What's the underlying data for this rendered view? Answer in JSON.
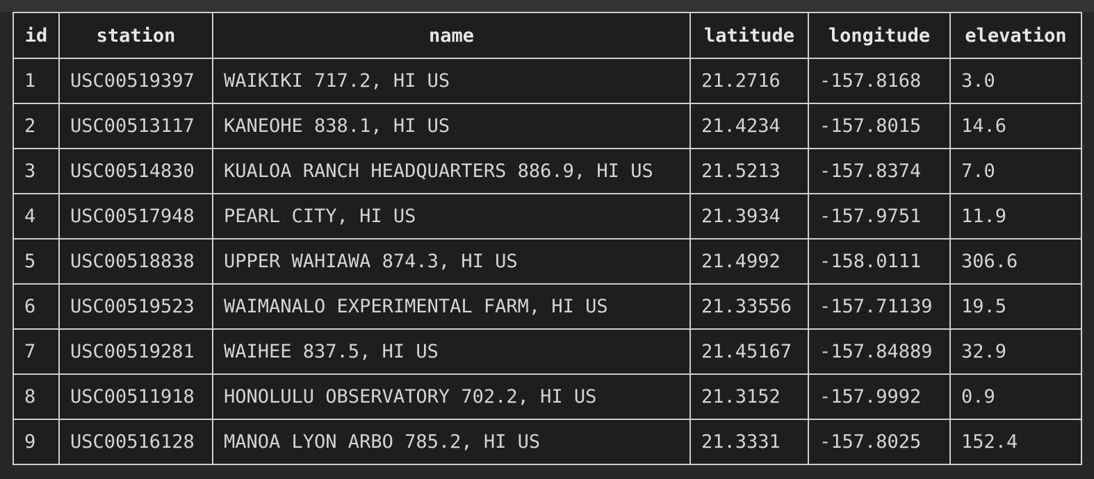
{
  "table": {
    "columns": [
      "id",
      "station",
      "name",
      "latitude",
      "longitude",
      "elevation"
    ],
    "rows": [
      [
        "1",
        "USC00519397",
        "WAIKIKI 717.2, HI US",
        "21.2716",
        "-157.8168",
        "3.0"
      ],
      [
        "2",
        "USC00513117",
        "KANEOHE 838.1, HI US",
        "21.4234",
        "-157.8015",
        "14.6"
      ],
      [
        "3",
        "USC00514830",
        "KUALOA RANCH HEADQUARTERS 886.9, HI US",
        "21.5213",
        "-157.8374",
        "7.0"
      ],
      [
        "4",
        "USC00517948",
        "PEARL CITY, HI US",
        "21.3934",
        "-157.9751",
        "11.9"
      ],
      [
        "5",
        "USC00518838",
        "UPPER WAHIAWA 874.3, HI US",
        "21.4992",
        "-158.0111",
        "306.6"
      ],
      [
        "6",
        "USC00519523",
        "WAIMANALO EXPERIMENTAL FARM, HI US",
        "21.33556",
        "-157.71139",
        "19.5"
      ],
      [
        "7",
        "USC00519281",
        "WAIHEE 837.5, HI US",
        "21.45167",
        "-157.84889",
        "32.9"
      ],
      [
        "8",
        "USC00511918",
        "HONOLULU OBSERVATORY 702.2, HI US",
        "21.3152",
        "-157.9992",
        "0.9"
      ],
      [
        "9",
        "USC00516128",
        "MANOA LYON ARBO 785.2, HI US",
        "21.3331",
        "-157.8025",
        "152.4"
      ]
    ]
  }
}
